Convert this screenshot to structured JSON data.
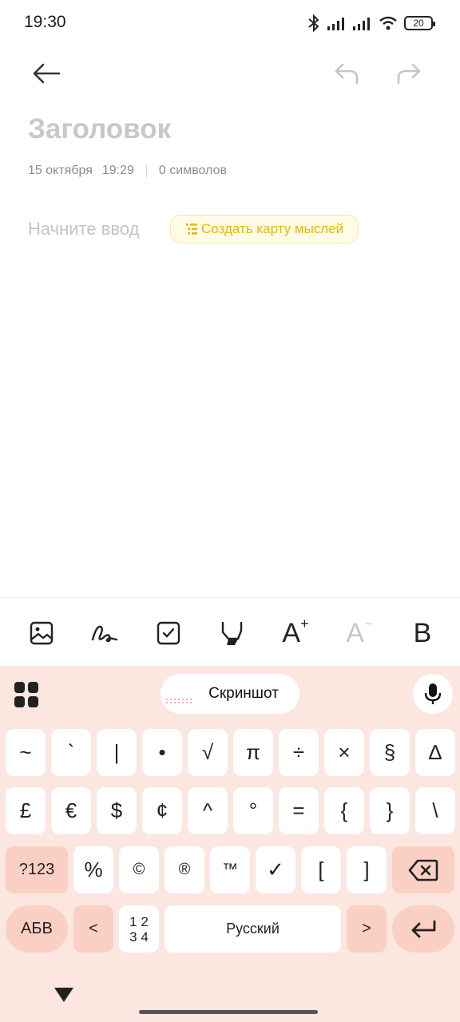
{
  "status": {
    "time": "19:30",
    "battery": "20"
  },
  "note": {
    "title_placeholder": "Заголовок",
    "date": "15 октября",
    "time": "19:29",
    "char_count": "0 символов",
    "body_placeholder": "Начните ввод",
    "mindmap_button": "Создать карту мыслей"
  },
  "toolbar": {
    "font_up": "A",
    "font_down": "A",
    "bold": "B"
  },
  "keyboard": {
    "suggestion": "Скриншот",
    "row1": [
      "~",
      "`",
      "|",
      "•",
      "√",
      "π",
      "÷",
      "×",
      "§",
      "∆"
    ],
    "row2": [
      "£",
      "€",
      "$",
      "¢",
      "^",
      "°",
      "=",
      "{",
      "}",
      "\\"
    ],
    "row3_mode": "?123",
    "row3": [
      "%",
      "©",
      "®",
      "™",
      "✓",
      "[",
      "]"
    ],
    "row4_lang_switch": "АБВ",
    "row4_left": "<",
    "row4_pages": "1 2\n3 4",
    "row4_space": "Русский",
    "row4_right": ">"
  },
  "colors": {
    "accent": "#e5b800",
    "keyboard_bg": "#fbe6e0",
    "func_key": "#fbd0c4"
  }
}
